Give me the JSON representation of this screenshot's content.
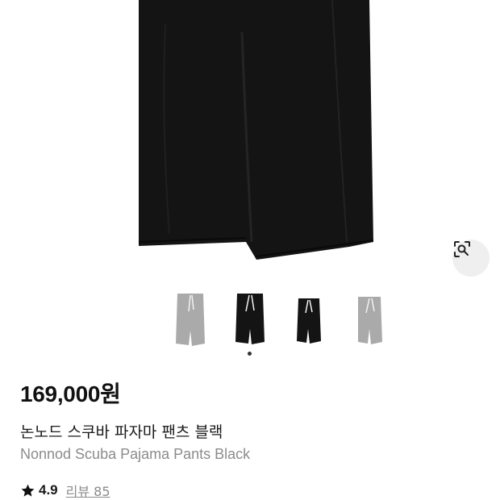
{
  "product": {
    "price": "169,000원",
    "name_ko": "논노드 스쿠바 파자마 팬츠 블랙",
    "name_en": "Nonnod Scuba Pajama Pants Black",
    "rating": "4.9",
    "review_label": "리뷰 85"
  },
  "gallery": {
    "thumbnails": [
      {
        "color": "gray"
      },
      {
        "color": "black"
      },
      {
        "color": "black"
      },
      {
        "color": "gray"
      }
    ],
    "active_index": 1
  },
  "icons": {
    "lens": "visual-search-icon",
    "star": "star-icon"
  },
  "colors": {
    "pants_black": "#141414",
    "pants_gray": "#a9aaa9",
    "muted_text": "#8c8c8c",
    "lens_bg": "#efefef"
  }
}
